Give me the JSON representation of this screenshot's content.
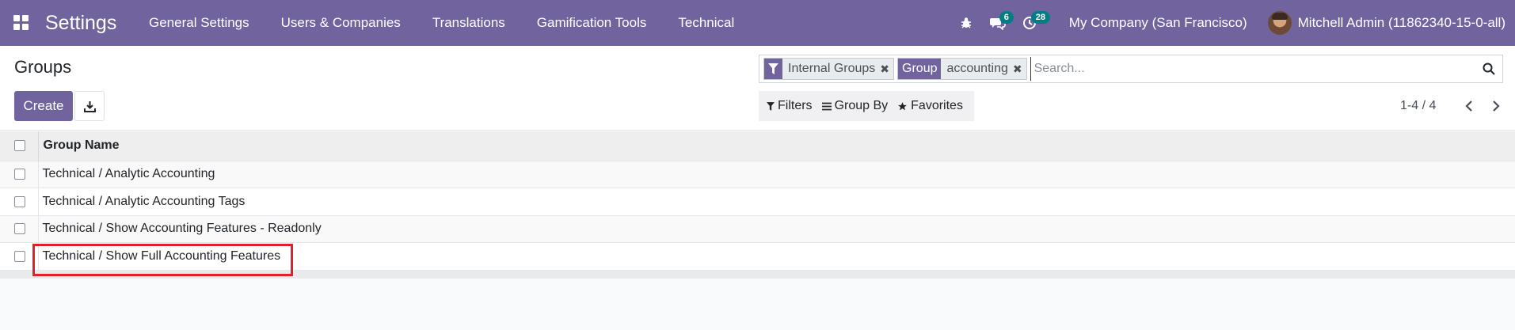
{
  "navbar": {
    "brand": "Settings",
    "menu": [
      {
        "label": "General Settings"
      },
      {
        "label": "Users & Companies"
      },
      {
        "label": "Translations"
      },
      {
        "label": "Gamification Tools"
      },
      {
        "label": "Technical"
      }
    ],
    "messages_badge": "6",
    "activities_badge": "28",
    "company": "My Company (San Francisco)",
    "user": "Mitchell Admin (11862340-15-0-all)"
  },
  "control_panel": {
    "breadcrumb": "Groups",
    "create_label": "Create",
    "search": {
      "facets": [
        {
          "label_icon": "filter-icon",
          "value": "Internal Groups"
        },
        {
          "label": "Group",
          "value": "accounting"
        }
      ],
      "placeholder": "Search..."
    },
    "filters_label": "Filters",
    "groupby_label": "Group By",
    "favorites_label": "Favorites",
    "pager": "1-4 / 4"
  },
  "list": {
    "column_header": "Group Name",
    "rows": [
      {
        "name": "Technical / Analytic Accounting"
      },
      {
        "name": "Technical / Analytic Accounting Tags"
      },
      {
        "name": "Technical / Show Accounting Features - Readonly"
      },
      {
        "name": "Technical / Show Full Accounting Features"
      }
    ]
  },
  "colors": {
    "brand": "#71639e",
    "badge": "#017e84",
    "highlight": "#e0202a"
  }
}
